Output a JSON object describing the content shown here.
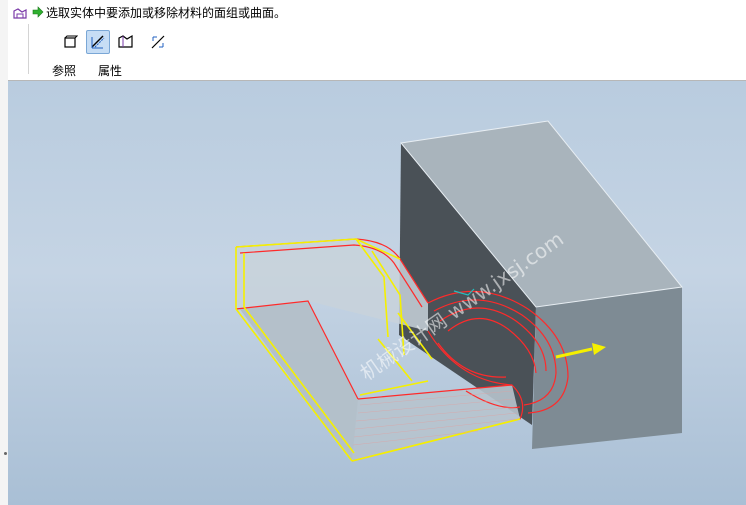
{
  "dashboard": {
    "prompt": "选取实体中要添加或移除材料的面组或曲面。",
    "tabs": [
      {
        "label": "参照"
      },
      {
        "label": "属性"
      }
    ],
    "tools": [
      {
        "icon": "solid-icon"
      },
      {
        "icon": "surface-thicken-icon",
        "active": true
      },
      {
        "icon": "quilt-icon"
      },
      {
        "icon": "flip-direction-icon"
      }
    ]
  },
  "viewport": {
    "watermark": "机械设计网 www.jxsj.com",
    "colors": {
      "block_face": "#7e8b94",
      "block_top": "#a9b4bc",
      "block_side": "#4a5157",
      "highlight_red": "#ff2a2a",
      "highlight_yellow": "#f5f000"
    }
  }
}
